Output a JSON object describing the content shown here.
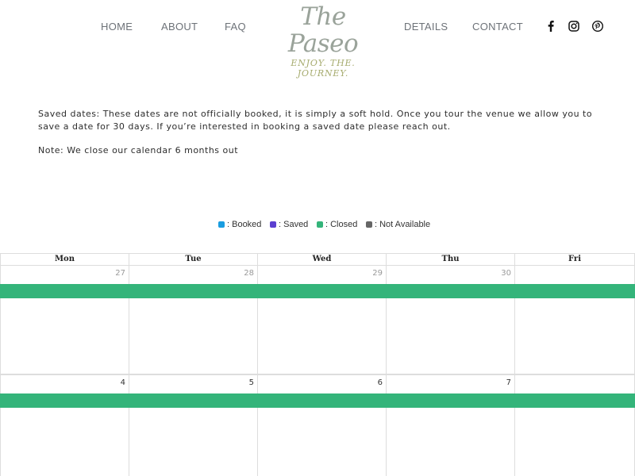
{
  "nav": {
    "links": [
      "HOME",
      "ABOUT",
      "FAQ",
      "DETAILS",
      "CONTACT"
    ],
    "logo": {
      "script": "The Paseo",
      "tagline": "ENJOY. THE. JOURNEY."
    },
    "social": [
      "facebook-icon",
      "instagram-icon",
      "pinterest-icon"
    ]
  },
  "notes": {
    "saved_dates": "Saved dates: These dates are not officially booked, it is simply a soft hold. Once you tour the venue we allow you to save a date for 30 days. If you’re interested in booking a saved date please reach out.",
    "calendar_note": "Note: We close our calendar 6 months out"
  },
  "legend": [
    {
      "label": ": Booked",
      "color": "#1a9de0"
    },
    {
      "label": ": Saved",
      "color": "#5b3fd0"
    },
    {
      "label": ": Closed",
      "color": "#34b47a"
    },
    {
      "label": ": Not Available",
      "color": "#666666"
    }
  ],
  "calendar": {
    "weekdays": [
      "Mon",
      "Tue",
      "Wed",
      "Thu",
      "Fri"
    ],
    "weeks": [
      {
        "days": [
          "27",
          "28",
          "29",
          "30",
          ""
        ],
        "muted": true,
        "status": "closed"
      },
      {
        "days": [
          "4",
          "5",
          "6",
          "7",
          ""
        ],
        "muted": false,
        "status": "closed"
      }
    ],
    "closed_color": "#34b47a"
  }
}
